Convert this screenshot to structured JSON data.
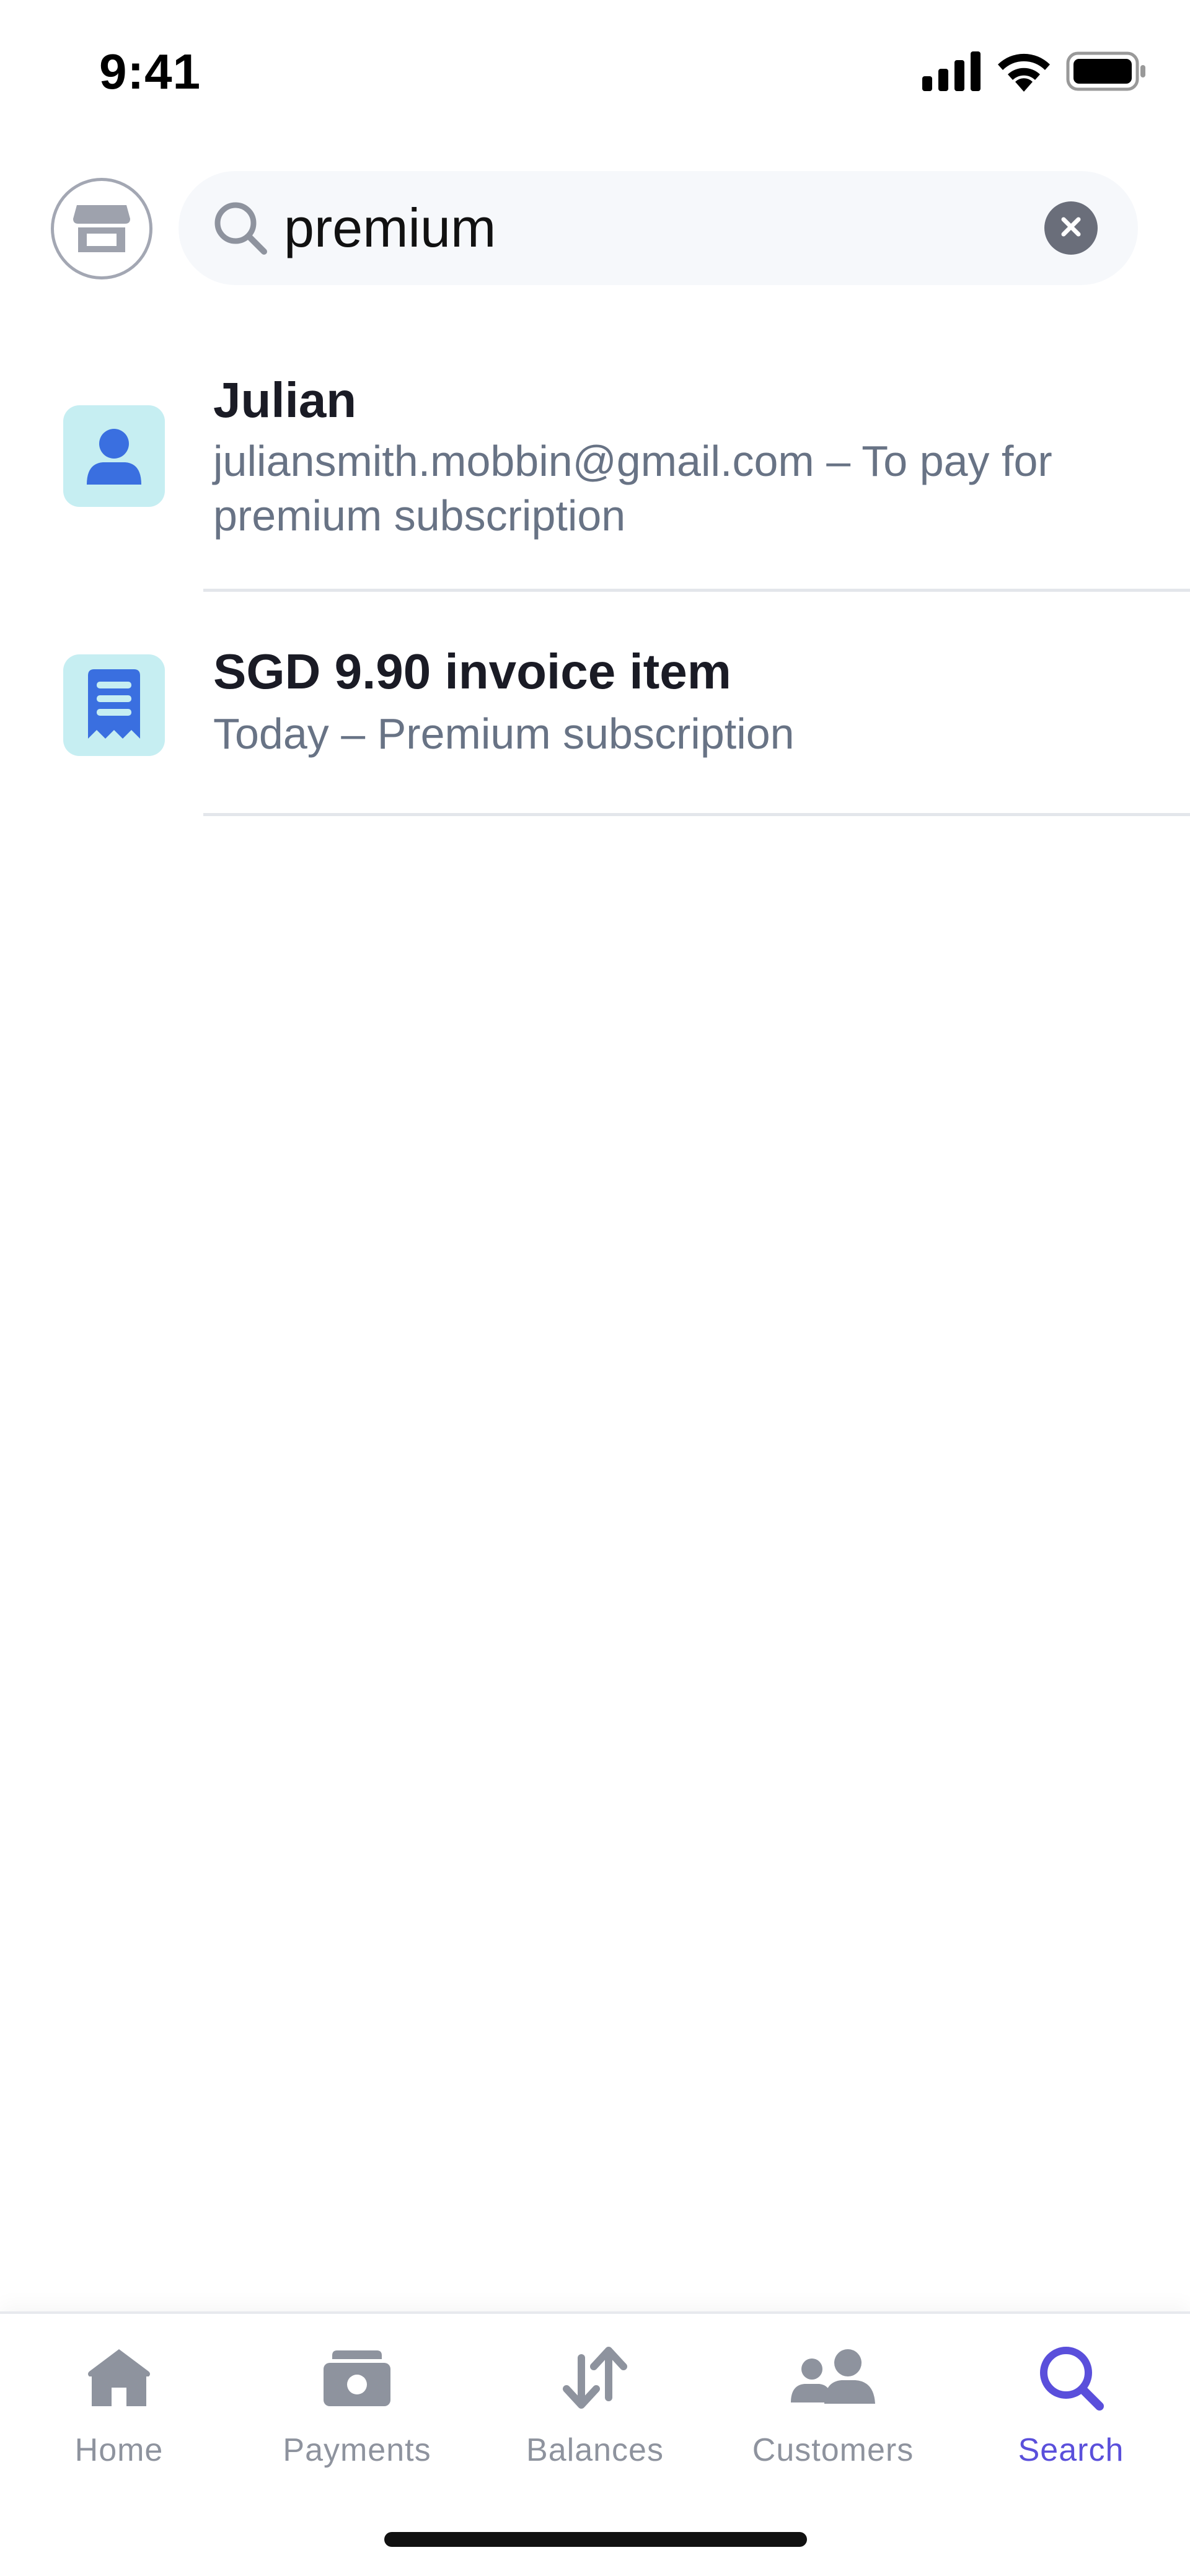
{
  "status_bar": {
    "time": "9:41",
    "icons": [
      "cellular-signal-icon",
      "wifi-icon",
      "battery-icon"
    ]
  },
  "header": {
    "store_icon": "storefront-icon",
    "search": {
      "icon": "search-icon",
      "value": "premium",
      "clear_icon": "clear-x-icon"
    }
  },
  "results": [
    {
      "icon": "customer-icon",
      "title": "Julian",
      "subtitle": "juliansmith.mobbin@gmail.com – To pay for premium subscription"
    },
    {
      "icon": "invoice-receipt-icon",
      "title": "SGD 9.90 invoice item",
      "subtitle": "Today – Premium subscription"
    }
  ],
  "tab_bar": {
    "tabs": [
      {
        "label": "Home",
        "icon": "home-icon",
        "active": false
      },
      {
        "label": "Payments",
        "icon": "payments-icon",
        "active": false
      },
      {
        "label": "Balances",
        "icon": "balances-arrows-icon",
        "active": false
      },
      {
        "label": "Customers",
        "icon": "customers-icon",
        "active": false
      },
      {
        "label": "Search",
        "icon": "search-icon",
        "active": true
      }
    ]
  },
  "colors": {
    "accent": "#5a4fdb",
    "icon_tile": "#c6eef2",
    "icon_blue": "#3a6fe0",
    "inactive": "#8e939e",
    "subtitle": "#687385"
  }
}
